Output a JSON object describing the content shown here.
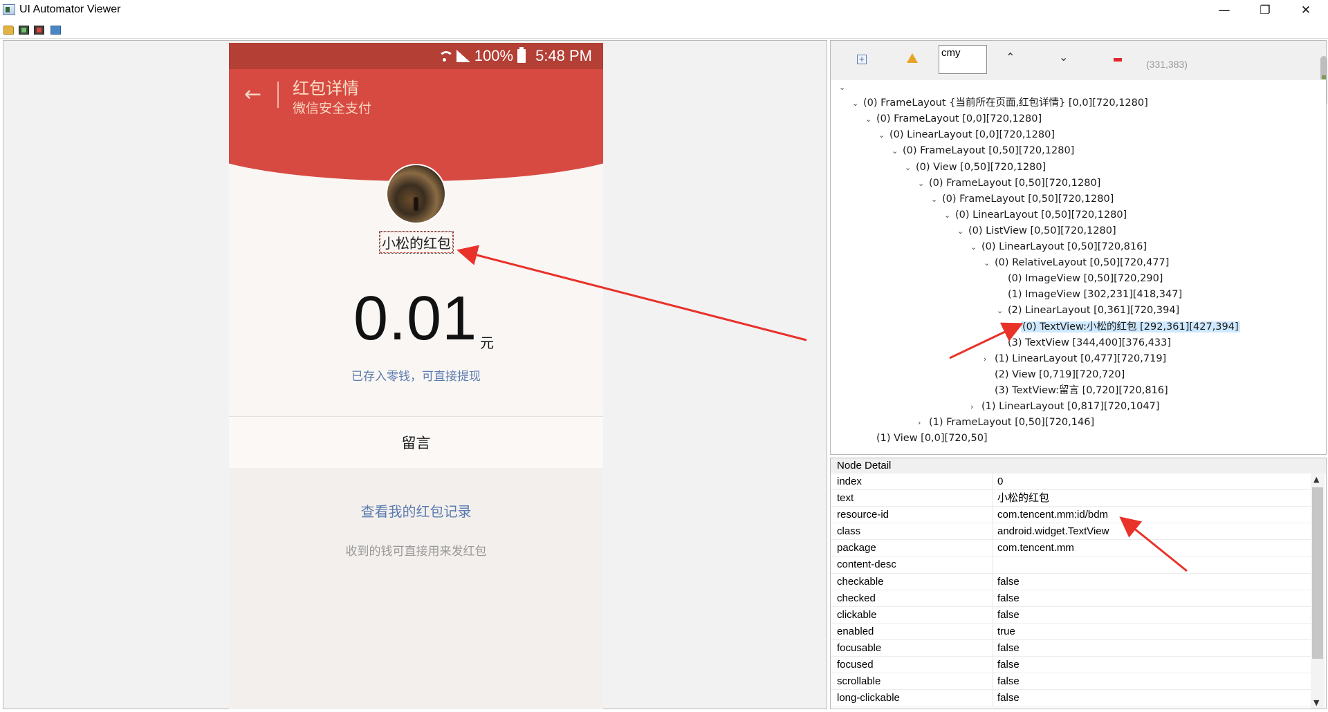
{
  "window": {
    "title": "UI Automator Viewer",
    "minimize": "—",
    "maximize": "❐",
    "close": "✕"
  },
  "toolbar": {
    "icons": [
      "open-folder-icon",
      "device-screenshot-icon",
      "device-screenshot-compressed-icon",
      "save-icon"
    ]
  },
  "phone": {
    "status": {
      "battery": "100%",
      "time": "5:48 PM"
    },
    "header_title": "红包详情",
    "header_subtitle": "微信安全支付",
    "sender": "小松的红包",
    "amount": "0.01",
    "currency": "元",
    "deposit_note": "已存入零钱，可直接提现",
    "message_label": "留言",
    "records_link": "查看我的红包记录",
    "records_note": "收到的钱可直接用来发红包"
  },
  "tree_toolbar": {
    "search_value": "cmy",
    "coords": "(331,383)"
  },
  "tree": [
    {
      "depth": 0,
      "chevron": "⌄",
      "label": ""
    },
    {
      "depth": 1,
      "chevron": "⌄",
      "label": "(0) FrameLayout {当前所在页面,红包详情} [0,0][720,1280]"
    },
    {
      "depth": 2,
      "chevron": "⌄",
      "label": "(0) FrameLayout [0,0][720,1280]"
    },
    {
      "depth": 3,
      "chevron": "⌄",
      "label": "(0) LinearLayout [0,0][720,1280]"
    },
    {
      "depth": 4,
      "chevron": "⌄",
      "label": "(0) FrameLayout [0,50][720,1280]"
    },
    {
      "depth": 5,
      "chevron": "⌄",
      "label": "(0) View [0,50][720,1280]"
    },
    {
      "depth": 6,
      "chevron": "⌄",
      "label": "(0) FrameLayout [0,50][720,1280]"
    },
    {
      "depth": 7,
      "chevron": "⌄",
      "label": "(0) FrameLayout [0,50][720,1280]"
    },
    {
      "depth": 8,
      "chevron": "⌄",
      "label": "(0) LinearLayout [0,50][720,1280]"
    },
    {
      "depth": 9,
      "chevron": "⌄",
      "label": "(0) ListView [0,50][720,1280]"
    },
    {
      "depth": 10,
      "chevron": "⌄",
      "label": "(0) LinearLayout [0,50][720,816]"
    },
    {
      "depth": 11,
      "chevron": "⌄",
      "label": "(0) RelativeLayout [0,50][720,477]"
    },
    {
      "depth": 12,
      "chevron": "",
      "label": "(0) ImageView [0,50][720,290]"
    },
    {
      "depth": 12,
      "chevron": "",
      "label": "(1) ImageView [302,231][418,347]"
    },
    {
      "depth": 12,
      "chevron": "⌄",
      "label": "(2) LinearLayout [0,361][720,394]"
    },
    {
      "depth": 13,
      "chevron": "",
      "label": "(0) TextView:小松的红包 [292,361][427,394]",
      "selected": true
    },
    {
      "depth": 12,
      "chevron": "",
      "label": "(3) TextView [344,400][376,433]"
    },
    {
      "depth": 11,
      "chevron": "›",
      "label": "(1) LinearLayout [0,477][720,719]"
    },
    {
      "depth": 11,
      "chevron": "",
      "label": "(2) View [0,719][720,720]"
    },
    {
      "depth": 11,
      "chevron": "",
      "label": "(3) TextView:留言 [0,720][720,816]"
    },
    {
      "depth": 10,
      "chevron": "›",
      "label": "(1) LinearLayout [0,817][720,1047]"
    },
    {
      "depth": 6,
      "chevron": "›",
      "label": "(1) FrameLayout [0,50][720,146]"
    },
    {
      "depth": 2,
      "chevron": "",
      "label": "(1) View [0,0][720,50]"
    }
  ],
  "detail": {
    "title": "Node Detail",
    "rows": [
      {
        "key": "index",
        "value": "0"
      },
      {
        "key": "text",
        "value": "小松的红包"
      },
      {
        "key": "resource-id",
        "value": "com.tencent.mm:id/bdm"
      },
      {
        "key": "class",
        "value": "android.widget.TextView"
      },
      {
        "key": "package",
        "value": "com.tencent.mm"
      },
      {
        "key": "content-desc",
        "value": ""
      },
      {
        "key": "checkable",
        "value": "false"
      },
      {
        "key": "checked",
        "value": "false"
      },
      {
        "key": "clickable",
        "value": "false"
      },
      {
        "key": "enabled",
        "value": "true"
      },
      {
        "key": "focusable",
        "value": "false"
      },
      {
        "key": "focused",
        "value": "false"
      },
      {
        "key": "scrollable",
        "value": "false"
      },
      {
        "key": "long-clickable",
        "value": "false"
      }
    ]
  },
  "colors": {
    "header_red": "#d74a42",
    "status_red": "#b33f35",
    "link_blue": "#5b7cb0",
    "selection": "#cde8ff",
    "arrow_red": "#e8322a"
  }
}
